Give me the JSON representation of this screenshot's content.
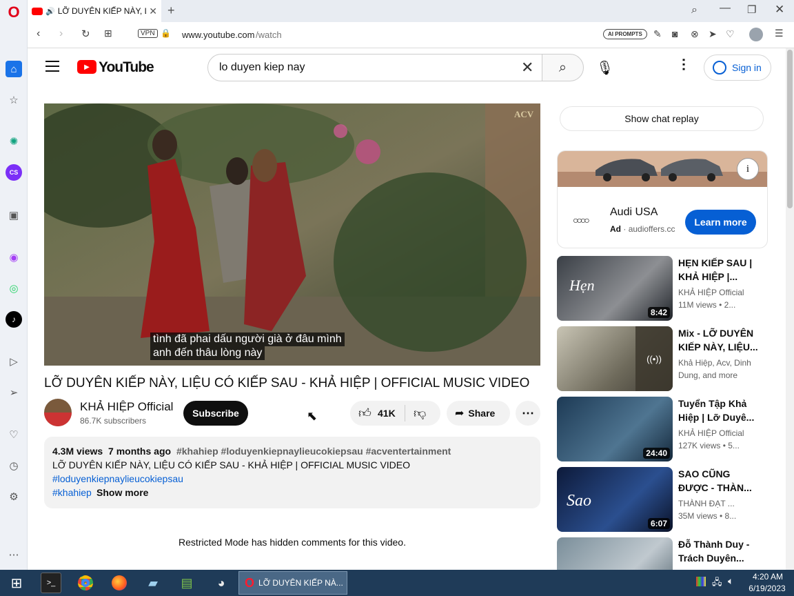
{
  "browser": {
    "tab_title": "LỠ DUYÊN KIẾP NÀY, LI",
    "new_tab": "+",
    "url_host": "www.youtube.com",
    "url_path": "/watch",
    "vpn_label": "VPN",
    "ai_prompts": "AI PROMPTS"
  },
  "youtube": {
    "logo_text": "YouTube",
    "search_value": "lo duyen kiep nay",
    "sign_in": "Sign in",
    "subtitle_line1": "tình đã phai dấu người già ở đâu mình",
    "subtitle_line2": "anh đến thâu lòng này",
    "watermark": "ACV",
    "video_title": "LỠ DUYÊN KIẾP NÀY, LIỆU CÓ KIẾP SAU - KHẢ HIỆP | OFFICIAL MUSIC VIDEO",
    "channel_name": "KHẢ HIỆP Official",
    "subscribers": "86.7K subscribers",
    "subscribe": "Subscribe",
    "likes": "41K",
    "share": "Share",
    "desc": {
      "views": "4.3M views",
      "age": "7 months ago",
      "tags": "#khahiep #loduyenkiepnaylieucokiepsau #acventertainment",
      "line": "LỠ DUYÊN KIẾP NÀY, LIỆU CÓ KIẾP SAU - KHẢ HIỆP | OFFICIAL MUSIC VIDEO",
      "hash1": "#loduyenkiepnaylieucokiepsau",
      "hash2": "#khahiep",
      "show_more": "Show more"
    },
    "restricted": "Restricted Mode has hidden comments for this video.",
    "chat_replay": "Show chat replay",
    "ad": {
      "brand": "Audi USA",
      "label": "Ad",
      "domain": "audioffers.cc",
      "cta": "Learn more"
    },
    "recs": [
      {
        "title": "HẸN KIẾP SAU | KHẢ HIỆP |...",
        "channel": "KHẢ HIỆP Official",
        "meta": "11M views • 2...",
        "duration": "8:42"
      },
      {
        "title": "Mix - LỠ DUYÊN KIẾP NÀY, LIỆU...",
        "channel": "Khả Hiệp, Acv, Dinh",
        "meta": "Dung, and more",
        "duration": ""
      },
      {
        "title": "Tuyển Tập Khả Hiệp | Lỡ Duyê...",
        "channel": "KHẢ HIỆP Official",
        "meta": "127K views • 5...",
        "duration": "24:40"
      },
      {
        "title": "SAO CŨNG ĐƯỢC - THÀN...",
        "channel": "THÀNH ĐẠT ...",
        "meta": "35M views • 8...",
        "duration": "6:07"
      },
      {
        "title": "Đỗ Thành Duy - Trách Duyên...",
        "channel": "",
        "meta": "",
        "duration": ""
      }
    ]
  },
  "taskbar": {
    "app_label": "LỠ DUYÊN KIẾP NÀ...",
    "time": "4:20 AM",
    "date": "6/19/2023"
  },
  "colors": {
    "youtube_red": "#ff0000",
    "link_blue": "#065fd4",
    "ad_button": "#065fd4",
    "taskbar": "#1f3b58"
  }
}
